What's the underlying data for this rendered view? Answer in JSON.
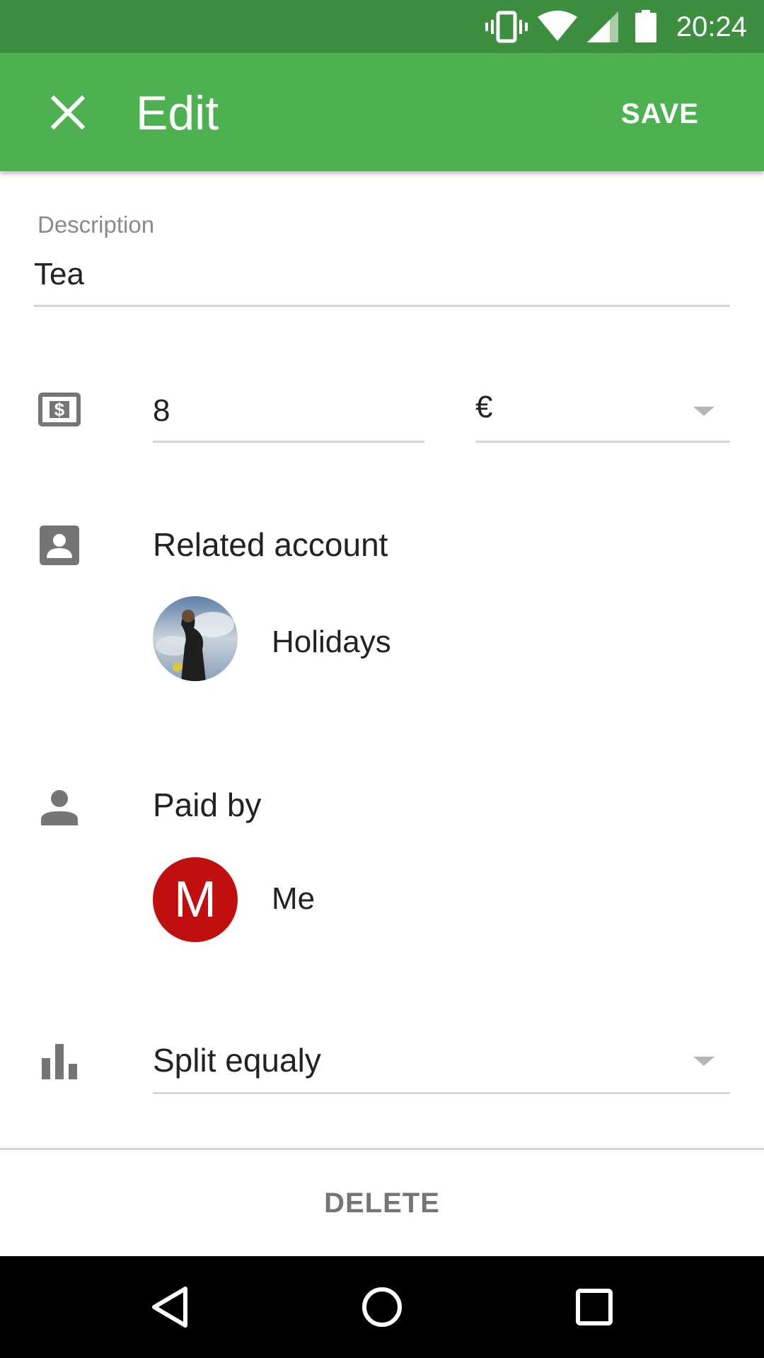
{
  "status_bar": {
    "time": "20:24",
    "icons": [
      "vibrate-icon",
      "wifi-icon",
      "signal-icon",
      "battery-icon"
    ]
  },
  "app_bar": {
    "title": "Edit",
    "close_icon": "close-icon",
    "save_label": "SAVE",
    "color": "#4eb151",
    "status_color": "#3b8f3e"
  },
  "form": {
    "description": {
      "label": "Description",
      "value": "Tea"
    },
    "amount": {
      "icon": "money-icon",
      "value": "8",
      "currency": "€"
    },
    "related_account": {
      "icon": "account-box-icon",
      "title": "Related account",
      "name": "Holidays"
    },
    "paid_by": {
      "icon": "person-icon",
      "title": "Paid by",
      "avatar_letter": "M",
      "name": "Me",
      "avatar_color": "#c10f0f"
    },
    "split": {
      "icon": "bar-chart-icon",
      "value": "Split equaly"
    }
  },
  "delete_label": "DELETE",
  "nav_bar": {
    "icons": [
      "back-icon",
      "home-icon",
      "recents-icon"
    ]
  }
}
